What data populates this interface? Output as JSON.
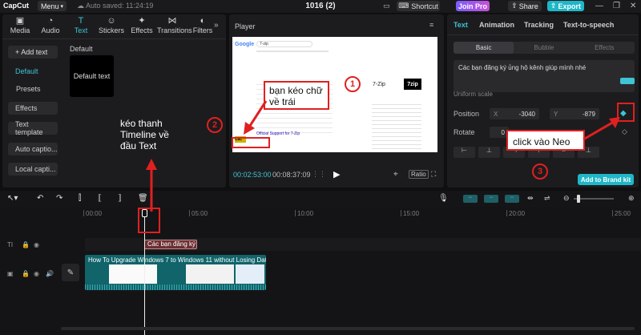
{
  "titlebar": {
    "logo": "CapCut",
    "menu": "Menu",
    "autosave": "Auto saved: 11:24:19",
    "project_title": "1016 (2)",
    "shortcut": "Shortcut",
    "join_pro": "Join Pro",
    "share": "Share",
    "export": "Export"
  },
  "media_tabs": [
    {
      "label": "Media",
      "icon": "media-icon"
    },
    {
      "label": "Audio",
      "icon": "audio-icon"
    },
    {
      "label": "Text",
      "icon": "text-icon"
    },
    {
      "label": "Stickers",
      "icon": "stickers-icon"
    },
    {
      "label": "Effects",
      "icon": "effects-icon"
    },
    {
      "label": "Transitions",
      "icon": "transitions-icon"
    },
    {
      "label": "Filters",
      "icon": "filters-icon"
    }
  ],
  "side_menu": {
    "add_text": "+ Add text",
    "default": "Default",
    "presets": "Presets",
    "effects": "Effects",
    "text_template": "Text template",
    "auto_captions": "Auto captio...",
    "local_captions": "Local capti..."
  },
  "content": {
    "section_title": "Default",
    "thumb_label": "Default text"
  },
  "player": {
    "title": "Player",
    "current_time": "00:02:53:00",
    "total_time": "00:08:37:09",
    "ratio": "Ratio",
    "frame": {
      "search_text": "7-zip",
      "overlay_title": "7-Zip",
      "support_text": "Official Support for 7-Zip"
    }
  },
  "props": {
    "tabs": [
      "Text",
      "Animation",
      "Tracking",
      "Text-to-speech"
    ],
    "sub_tabs": [
      "Basic",
      "Bubble",
      "Effects"
    ],
    "text_value": "Các bạn đăng ký ủng hộ kênh giúp mình nhé",
    "uniform_scale": "Uniform scale",
    "position_label": "Position",
    "x_label": "X",
    "x_value": "-3040",
    "y_label": "Y",
    "y_value": "-879",
    "rotate_label": "Rotate",
    "rotate_value": "0",
    "add_brand_kit": "Add to Brand kit"
  },
  "timeline": {
    "ruler": [
      "00:00",
      "05:00",
      "10:00",
      "15:00",
      "20:00",
      "25:00"
    ],
    "text_clip": "Các bạn đăng ký",
    "video_clip": "How To Upgrade Windows 7 to Windows 11 without Losing Data fo"
  },
  "annotations": {
    "a1_text": "bạn kéo chữ về trái",
    "a1_num": "1",
    "a2_text": "kéo thanh Timeline về đầu Text",
    "a2_num": "2",
    "a3_text": "click vào Neo",
    "a3_num": "3"
  },
  "colors": {
    "accent": "#3fc4d4",
    "annotation_red": "#e02020",
    "text_clip": "#6b2f33",
    "video_clip": "#10646a"
  }
}
